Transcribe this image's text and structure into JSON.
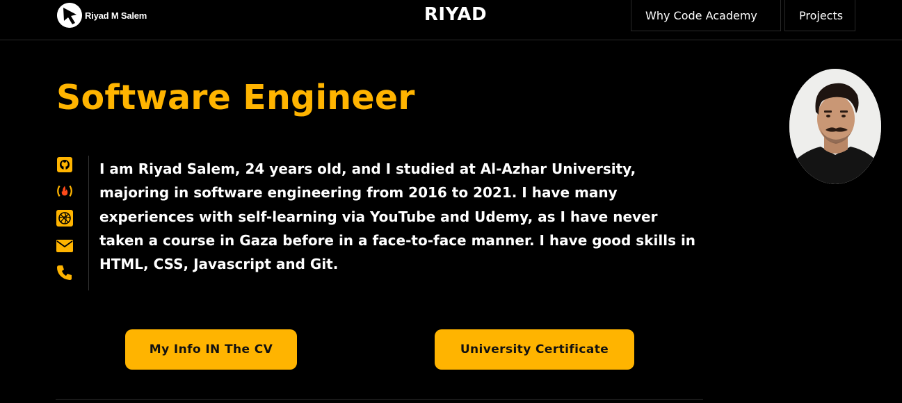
{
  "header": {
    "logo_text": "Riyad M Salem",
    "brand": "RIYAD",
    "nav": [
      {
        "label": "Why Code Academy"
      },
      {
        "label": "Projects"
      }
    ]
  },
  "hero": {
    "title": "Software Engineer",
    "bio": "I am Riyad Salem, 24 years old, and I studied at Al-Azhar University, majoring in software engineering from 2016 to 2021. I have many experiences with self-learning via YouTube and Udemy, as I have never taken a course in Gaza before in a face-to-face manner. I have good skills in HTML, CSS, Javascript and Git.",
    "social_icons": [
      "github-icon",
      "freecodecamp-icon",
      "codepen-icon",
      "mail-icon",
      "phone-icon"
    ]
  },
  "buttons": {
    "cv_label": "My Info IN The CV",
    "certificate_label": "University Certificate"
  },
  "colors": {
    "accent": "#ffb400",
    "background": "#000000",
    "text": "#ffffff"
  }
}
